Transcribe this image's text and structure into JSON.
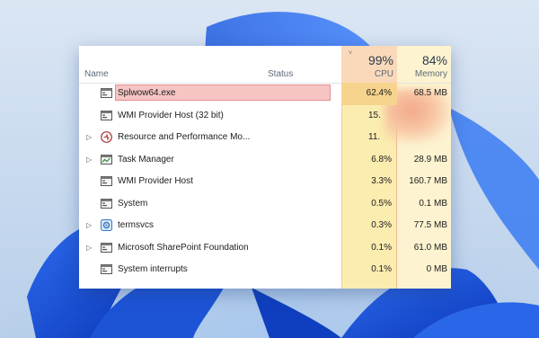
{
  "header": {
    "cpu_percent": "99%",
    "memory_percent": "84%",
    "name_label": "Name",
    "status_label": "Status",
    "cpu_label": "CPU",
    "memory_label": "Memory",
    "sort_indicator": "˅"
  },
  "processes": [
    {
      "name": "Splwow64.exe",
      "cpu": "62.4%",
      "memory": "68.5 MB",
      "expandable": false,
      "icon": "app-window-icon",
      "highlighted": true
    },
    {
      "name": "WMI Provider Host (32 bit)",
      "cpu": "15.",
      "memory": "",
      "expandable": false,
      "icon": "app-window-icon"
    },
    {
      "name": "Resource and Performance Mo...",
      "cpu": "11.",
      "memory": "",
      "expandable": true,
      "icon": "performance-monitor-icon"
    },
    {
      "name": "Task Manager",
      "cpu": "6.8%",
      "memory": "28.9 MB",
      "expandable": true,
      "icon": "task-manager-icon"
    },
    {
      "name": "WMI Provider Host",
      "cpu": "3.3%",
      "memory": "160.7 MB",
      "expandable": false,
      "icon": "app-window-icon"
    },
    {
      "name": "System",
      "cpu": "0.5%",
      "memory": "0.1 MB",
      "expandable": false,
      "icon": "app-window-icon"
    },
    {
      "name": "termsvcs",
      "cpu": "0.3%",
      "memory": "77.5 MB",
      "expandable": true,
      "icon": "service-gear-icon"
    },
    {
      "name": "Microsoft SharePoint Foundation",
      "cpu": "0.1%",
      "memory": "61.0 MB",
      "expandable": true,
      "icon": "app-window-icon"
    },
    {
      "name": "System interrupts",
      "cpu": "0.1%",
      "memory": "0 MB",
      "expandable": false,
      "icon": "app-window-icon"
    }
  ],
  "colors": {
    "highlight_fill": "#f7c4c4",
    "highlight_border": "#e58d8d",
    "cpu_band": "#fbecb0",
    "memory_band": "#fdf3d0"
  }
}
